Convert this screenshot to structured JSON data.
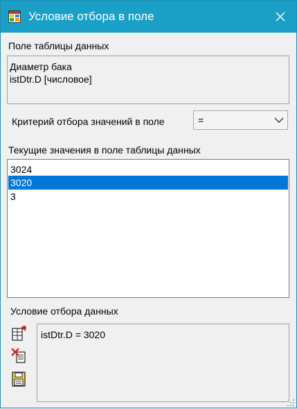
{
  "window": {
    "title": "Условие отбора в поле",
    "title_bar_color": "#1aa0c7",
    "icons": {
      "app": "table-app-icon",
      "close": "close-icon"
    }
  },
  "field_section": {
    "label": "Поле таблицы данных",
    "field_name": "Диаметр бака",
    "field_id": "istDtr.D [числовое]"
  },
  "criterion": {
    "label": "Критерий отбора значений в поле",
    "selected": "="
  },
  "values_section": {
    "label": "Текущие значения в поле таблицы данных",
    "items": [
      "3024",
      "3020",
      "3"
    ],
    "selected_index": 1,
    "selection_color": "#0078d7"
  },
  "condition_section": {
    "label": "Условие отбора данных",
    "text": "istDtr.D = 3020",
    "tools": [
      "add-condition-icon",
      "delete-condition-icon",
      "save-condition-icon"
    ]
  }
}
